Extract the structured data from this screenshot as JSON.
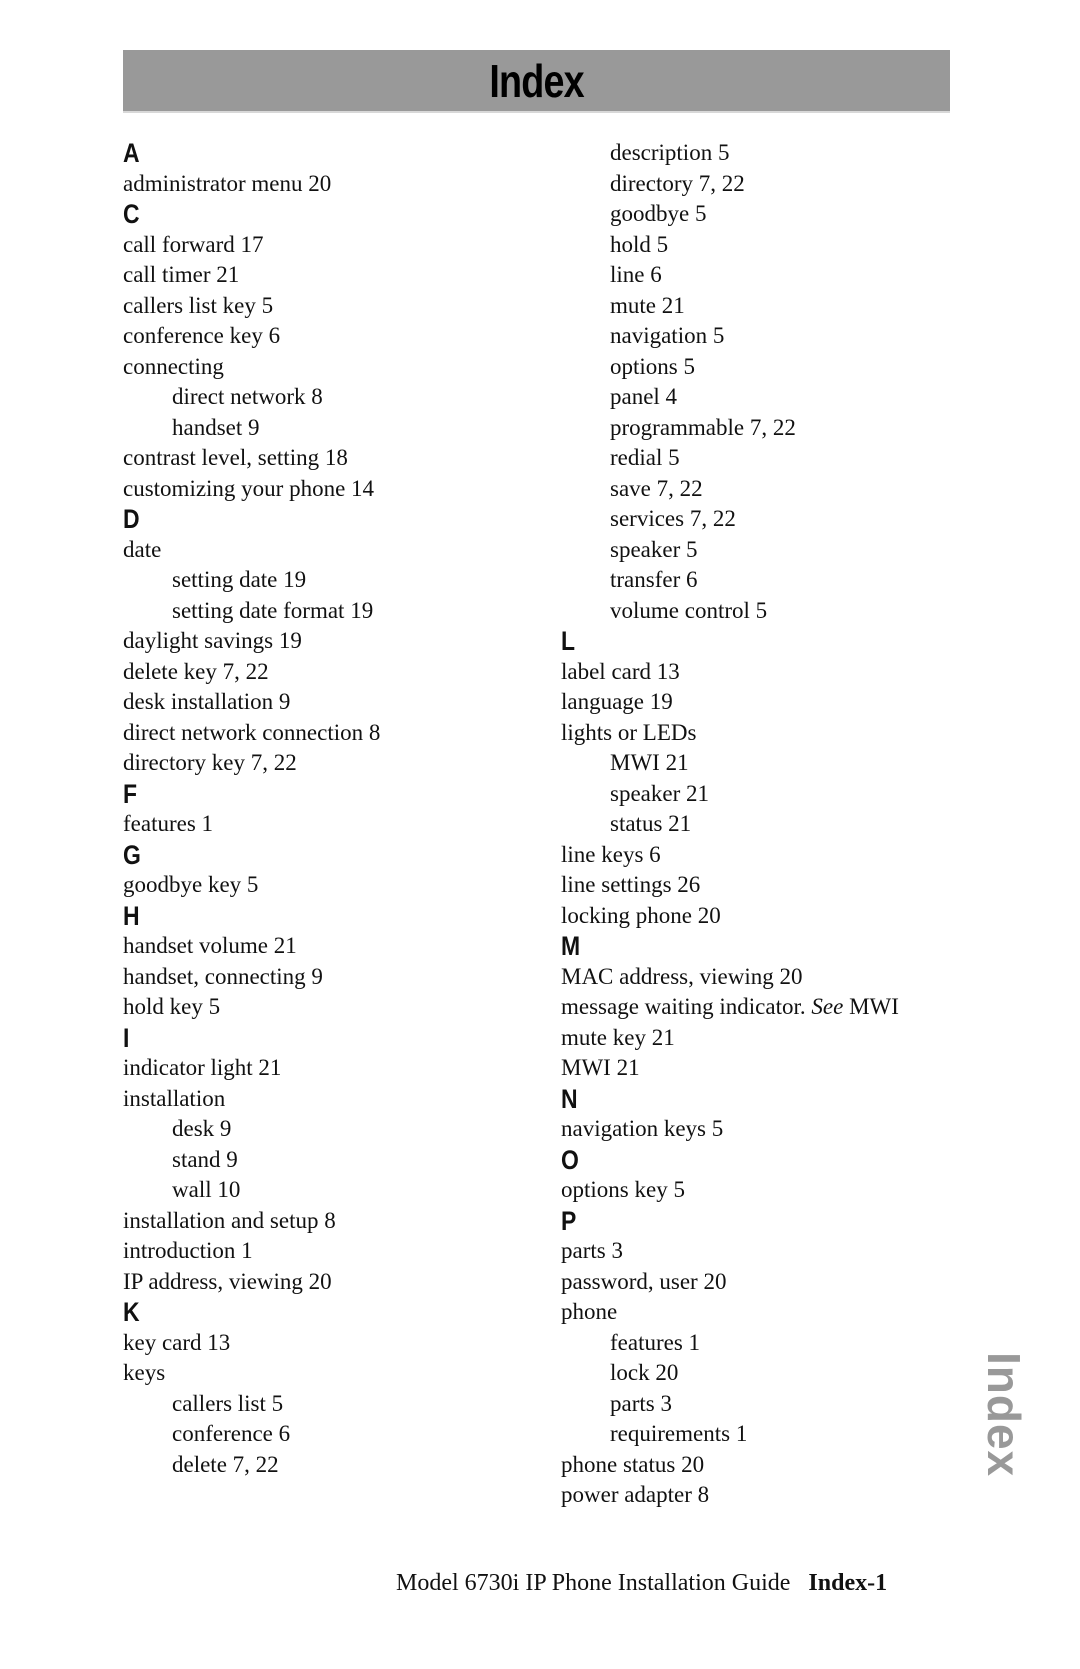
{
  "title": "Index",
  "side_tab": "Index",
  "footer": {
    "guide": "Model 6730i IP Phone Installation Guide",
    "page": "Index-1"
  },
  "left_column": [
    {
      "type": "letter",
      "text": "A"
    },
    {
      "type": "entry",
      "text": "administrator menu 20"
    },
    {
      "type": "letter",
      "text": "C"
    },
    {
      "type": "entry",
      "text": "call forward 17"
    },
    {
      "type": "entry",
      "text": "call timer 21"
    },
    {
      "type": "entry",
      "text": "callers list key 5"
    },
    {
      "type": "entry",
      "text": "conference key 6"
    },
    {
      "type": "entry",
      "text": "connecting"
    },
    {
      "type": "entry",
      "text": "direct network 8",
      "indent": true
    },
    {
      "type": "entry",
      "text": "handset 9",
      "indent": true
    },
    {
      "type": "entry",
      "text": "contrast level, setting 18"
    },
    {
      "type": "entry",
      "text": "customizing your phone 14"
    },
    {
      "type": "letter",
      "text": "D"
    },
    {
      "type": "entry",
      "text": "date"
    },
    {
      "type": "entry",
      "text": "setting date 19",
      "indent": true
    },
    {
      "type": "entry",
      "text": "setting date format 19",
      "indent": true
    },
    {
      "type": "entry",
      "text": "daylight savings 19"
    },
    {
      "type": "entry",
      "text": "delete key 7, 22"
    },
    {
      "type": "entry",
      "text": "desk installation 9"
    },
    {
      "type": "entry",
      "text": "direct network connection 8"
    },
    {
      "type": "entry",
      "text": "directory key 7, 22"
    },
    {
      "type": "letter",
      "text": "F"
    },
    {
      "type": "entry",
      "text": "features 1"
    },
    {
      "type": "letter",
      "text": "G"
    },
    {
      "type": "entry",
      "text": "goodbye key 5"
    },
    {
      "type": "letter",
      "text": "H"
    },
    {
      "type": "entry",
      "text": "handset volume 21"
    },
    {
      "type": "entry",
      "text": "handset, connecting 9"
    },
    {
      "type": "entry",
      "text": "hold key 5"
    },
    {
      "type": "letter",
      "text": "I"
    },
    {
      "type": "entry",
      "text": "indicator light 21"
    },
    {
      "type": "entry",
      "text": "installation"
    },
    {
      "type": "entry",
      "text": "desk 9",
      "indent": true
    },
    {
      "type": "entry",
      "text": "stand 9",
      "indent": true
    },
    {
      "type": "entry",
      "text": "wall 10",
      "indent": true
    },
    {
      "type": "entry",
      "text": "installation and setup 8"
    },
    {
      "type": "entry",
      "text": "introduction 1"
    },
    {
      "type": "entry",
      "text": "IP address, viewing 20"
    },
    {
      "type": "letter",
      "text": "K"
    },
    {
      "type": "entry",
      "text": "key card 13"
    },
    {
      "type": "entry",
      "text": "keys"
    },
    {
      "type": "entry",
      "text": "callers list 5",
      "indent": true
    },
    {
      "type": "entry",
      "text": "conference 6",
      "indent": true
    },
    {
      "type": "entry",
      "text": "delete 7, 22",
      "indent": true
    }
  ],
  "right_column": [
    {
      "type": "entry",
      "text": "description 5",
      "indent": true
    },
    {
      "type": "entry",
      "text": "directory 7, 22",
      "indent": true
    },
    {
      "type": "entry",
      "text": "goodbye 5",
      "indent": true
    },
    {
      "type": "entry",
      "text": "hold 5",
      "indent": true
    },
    {
      "type": "entry",
      "text": "line 6",
      "indent": true
    },
    {
      "type": "entry",
      "text": "mute 21",
      "indent": true
    },
    {
      "type": "entry",
      "text": "navigation 5",
      "indent": true
    },
    {
      "type": "entry",
      "text": "options 5",
      "indent": true
    },
    {
      "type": "entry",
      "text": "panel 4",
      "indent": true
    },
    {
      "type": "entry",
      "text": "programmable 7, 22",
      "indent": true
    },
    {
      "type": "entry",
      "text": "redial 5",
      "indent": true
    },
    {
      "type": "entry",
      "text": "save 7, 22",
      "indent": true
    },
    {
      "type": "entry",
      "text": "services 7, 22",
      "indent": true
    },
    {
      "type": "entry",
      "text": "speaker 5",
      "indent": true
    },
    {
      "type": "entry",
      "text": "transfer 6",
      "indent": true
    },
    {
      "type": "entry",
      "text": "volume control 5",
      "indent": true
    },
    {
      "type": "letter",
      "text": "L"
    },
    {
      "type": "entry",
      "text": "label card 13"
    },
    {
      "type": "entry",
      "text": "language 19"
    },
    {
      "type": "entry",
      "text": "lights or LEDs"
    },
    {
      "type": "entry",
      "text": "MWI 21",
      "indent": true
    },
    {
      "type": "entry",
      "text": "speaker 21",
      "indent": true
    },
    {
      "type": "entry",
      "text": "status 21",
      "indent": true
    },
    {
      "type": "entry",
      "text": "line keys 6"
    },
    {
      "type": "entry",
      "text": "line settings 26"
    },
    {
      "type": "entry",
      "text": "locking phone 20"
    },
    {
      "type": "letter",
      "text": "M"
    },
    {
      "type": "entry",
      "text": "MAC address, viewing 20"
    },
    {
      "type": "entry",
      "text": "message waiting indicator. ",
      "see": "See",
      "after": " MWI"
    },
    {
      "type": "entry",
      "text": "mute key 21"
    },
    {
      "type": "entry",
      "text": "MWI 21"
    },
    {
      "type": "letter",
      "text": "N"
    },
    {
      "type": "entry",
      "text": "navigation keys 5"
    },
    {
      "type": "letter",
      "text": "O"
    },
    {
      "type": "entry",
      "text": "options key 5"
    },
    {
      "type": "letter",
      "text": "P"
    },
    {
      "type": "entry",
      "text": "parts 3"
    },
    {
      "type": "entry",
      "text": "password, user 20"
    },
    {
      "type": "entry",
      "text": "phone"
    },
    {
      "type": "entry",
      "text": "features 1",
      "indent": true
    },
    {
      "type": "entry",
      "text": "lock 20",
      "indent": true
    },
    {
      "type": "entry",
      "text": "parts 3",
      "indent": true
    },
    {
      "type": "entry",
      "text": "requirements 1",
      "indent": true
    },
    {
      "type": "entry",
      "text": "phone status 20"
    },
    {
      "type": "entry",
      "text": "power adapter 8"
    }
  ]
}
